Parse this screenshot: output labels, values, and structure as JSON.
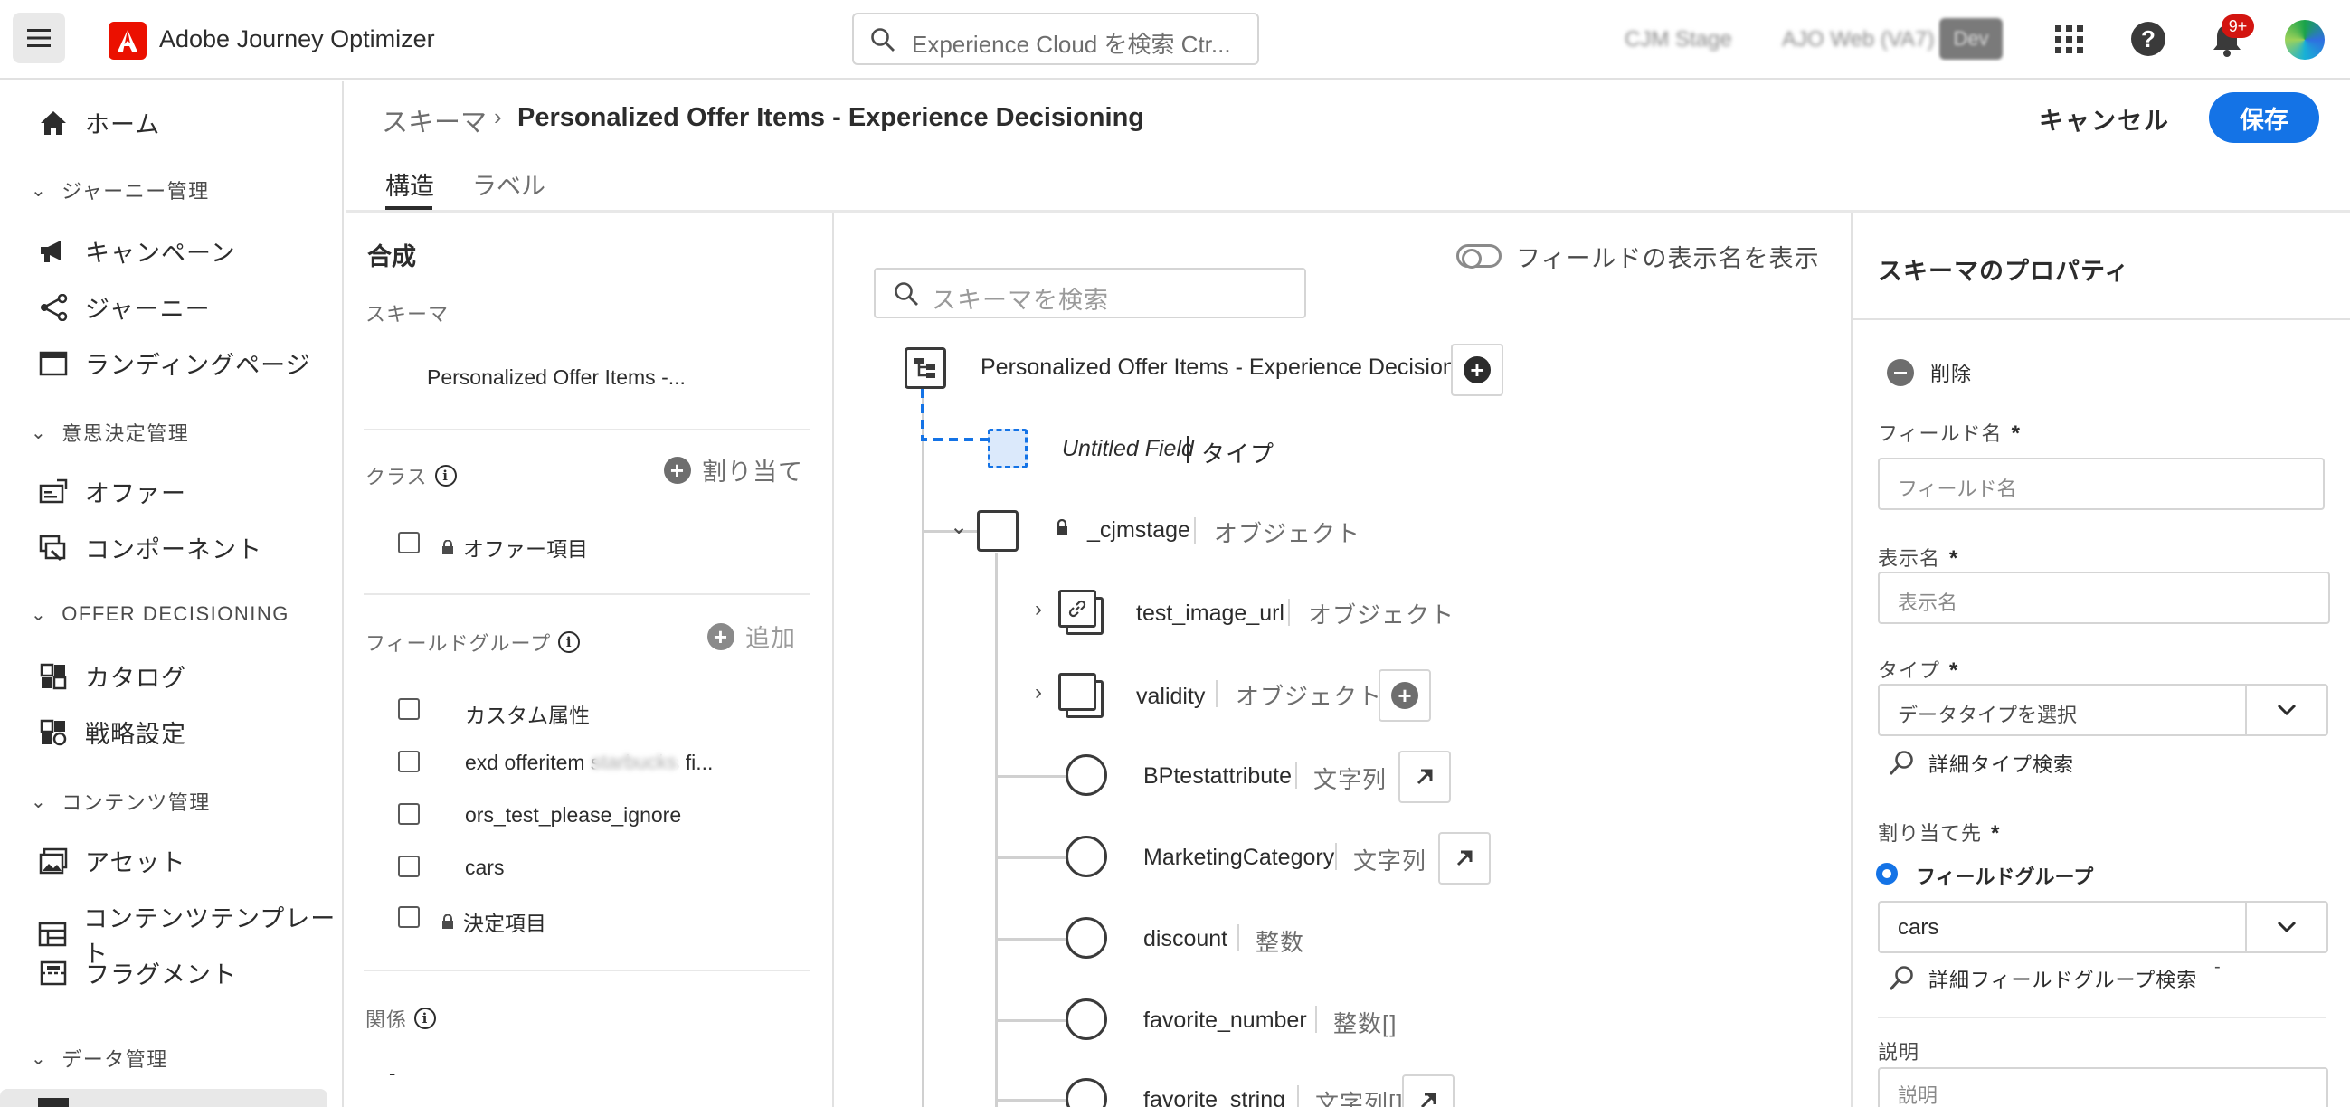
{
  "topbar": {
    "app_name": "Adobe Journey Optimizer",
    "search_placeholder": "Experience Cloud を検索 Ctr...",
    "org_1": "CJM Stage",
    "org_2": "AJO Web (VA7)",
    "env_badge": "Dev",
    "notification_count": "9+"
  },
  "leftnav": {
    "home": "ホーム",
    "section_journey": "ジャーニー管理",
    "campaigns": "キャンペーン",
    "journeys": "ジャーニー",
    "landing_pages": "ランディングページ",
    "section_decision": "意思決定管理",
    "offers": "オファー",
    "components": "コンポーネント",
    "section_offer_decisioning": "OFFER DECISIONING",
    "catalog": "カタログ",
    "strategy": "戦略設定",
    "section_content": "コンテンツ管理",
    "assets": "アセット",
    "content_templates": "コンテンツテンプレート",
    "fragments": "フラグメント",
    "section_data": "データ管理"
  },
  "header": {
    "breadcrumb_root": "スキーマ",
    "breadcrumb_sep": "›",
    "title": "Personalized Offer Items - Experience Decisioning",
    "cancel_label": "キャンセル",
    "save_label": "保存",
    "tab_structure": "構造",
    "tab_label": "ラベル"
  },
  "composition": {
    "heading": "合成",
    "schema_label": "スキーマ",
    "schema_name": "Personalized Offer Items -...",
    "class_label": "クラス",
    "assign_label": "割り当て",
    "class_item": "オファー項目",
    "fieldgroups_label": "フィールドグループ",
    "add_label": "追加",
    "fieldgroups": [
      {
        "name": "カスタム属性",
        "locked": false
      },
      {
        "name": "exd offeritem starbucks fi...",
        "locked": false
      },
      {
        "name": "ors_test_please_ignore",
        "locked": false
      },
      {
        "name": "cars",
        "locked": false
      },
      {
        "name": "決定項目",
        "locked": true
      }
    ],
    "relations_label": "関係",
    "relations_value": "-"
  },
  "canvas": {
    "toggle_label": "フィールドの表示名を表示",
    "search_placeholder": "スキーマを検索",
    "root_name": "Personalized Offer Items - Experience Decisioning",
    "untitled_field": "Untitled Field",
    "untitled_type": "タイプ",
    "nodes": [
      {
        "name": "_cjmstage",
        "type": "オブジェクト"
      },
      {
        "name": "test_image_url",
        "type": "オブジェクト"
      },
      {
        "name": "validity",
        "type": "オブジェクト"
      },
      {
        "name": "BPtestattribute",
        "type": "文字列"
      },
      {
        "name": "MarketingCategory",
        "type": "文字列"
      },
      {
        "name": "discount",
        "type": "整数"
      },
      {
        "name": "favorite_number",
        "type": "整数[]"
      },
      {
        "name": "favorite_string",
        "type": "文字列[]"
      }
    ]
  },
  "props": {
    "title": "スキーマのプロパティ",
    "delete_label": "削除",
    "field_name_label": "フィールド名",
    "field_name_placeholder": "フィールド名",
    "display_name_label": "表示名",
    "display_name_placeholder": "表示名",
    "type_label": "タイプ",
    "type_placeholder": "データタイプを選択",
    "advanced_type_search": "詳細タイプ検索",
    "assign_to_label": "割り当て先",
    "assign_option": "フィールドグループ",
    "fieldgroup_value": "cars",
    "advanced_fieldgroup_search": "詳細フィールドグループ検索",
    "stray_dash": "-",
    "description_label": "説明",
    "description_placeholder": "説明",
    "required_mark": "*"
  }
}
